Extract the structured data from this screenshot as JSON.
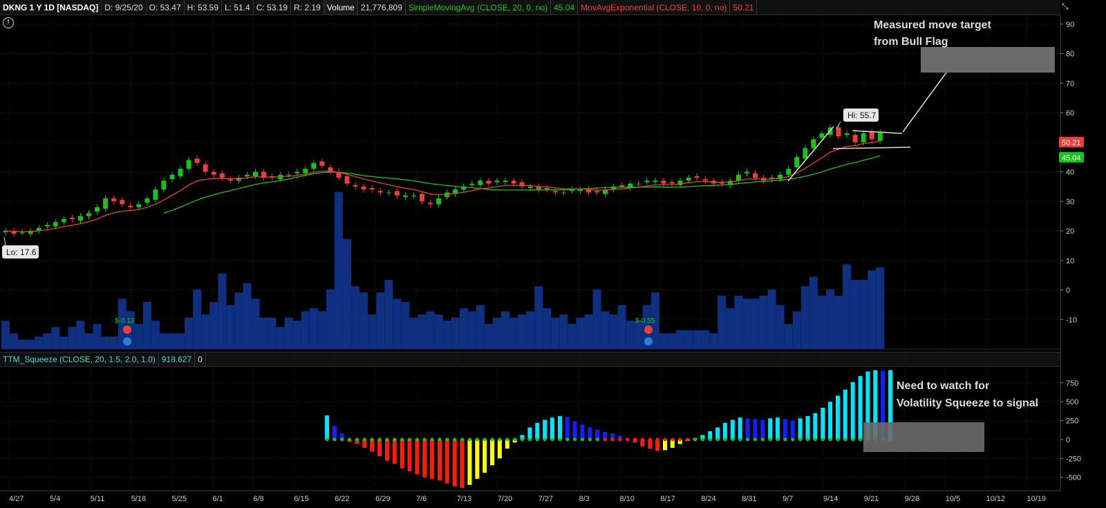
{
  "header": {
    "symbol": "DKNG 1 Y 1D [NASDAQ]",
    "date": "D: 9/25/20",
    "open": "O: 53.47",
    "high": "H: 53.59",
    "low": "L: 51.4",
    "close": "C: 53.19",
    "range": "R: 2.19",
    "volume_label": "Volume",
    "volume_value": "21,776,809",
    "sma_label": "SimpleMovingAvg (CLOSE, 20, 0, no)",
    "sma_value": "45.04",
    "ema_label": "MovAvgExponential (CLOSE, 10, 0, no)",
    "ema_value": "50.21",
    "colors": {
      "sma": "#19c21b",
      "ema": "#e8403a",
      "up": "#19c21b",
      "down": "#e8403a",
      "volume": "#0f2f80"
    }
  },
  "squeeze_header": {
    "label": "TTM_Squeeze (CLOSE, 20, 1.5, 2.0, 1.0)",
    "value": "918.627",
    "squeeze": "0"
  },
  "annotations": {
    "top_note": [
      "Measured move target",
      "from Bull Flag"
    ],
    "bottom_note": [
      "Need to watch for",
      "Volatility Squeeze to signal"
    ],
    "hi_label": "Hi: 55.7",
    "lo_label": "Lo: 17.6",
    "ema_badge": "50.21",
    "sma_badge": "45.04",
    "earnings_1": "$-0.13",
    "earnings_2": "$-0.55"
  },
  "chart_data": [
    {
      "type": "candlestick",
      "title": "DKNG 1 Y 1D [NASDAQ]",
      "x_labels": [
        "4/27",
        "5/4",
        "5/11",
        "5/18",
        "5/25",
        "6/1",
        "6/8",
        "6/15",
        "6/22",
        "6/29",
        "7/6",
        "7/13",
        "7/20",
        "7/27",
        "8/3",
        "8/10",
        "8/17",
        "8/24",
        "8/31",
        "9/7",
        "9/14",
        "9/21",
        "9/28",
        "10/5",
        "10/12",
        "10/19"
      ],
      "y_ticks": [
        -10,
        0,
        10,
        20,
        30,
        40,
        50,
        60,
        70,
        80,
        90
      ],
      "ylim": [
        -20,
        93
      ],
      "close": [
        20,
        19,
        19.5,
        20,
        21,
        22,
        23,
        24,
        24,
        25,
        26,
        28,
        31,
        30,
        29,
        28,
        29,
        31,
        34,
        37,
        39,
        41,
        44,
        43,
        40,
        39,
        38,
        37,
        38,
        39,
        40,
        38,
        38,
        39,
        39,
        40,
        41,
        43,
        42,
        40,
        38,
        36,
        35,
        34,
        34,
        33,
        33,
        32,
        32,
        32,
        30,
        29,
        31,
        33,
        34,
        35,
        36,
        37,
        36,
        37,
        37,
        36,
        35,
        35,
        34,
        34,
        33,
        33,
        34,
        34,
        33,
        33,
        34,
        35,
        35,
        36,
        36,
        37,
        37,
        36,
        36,
        37,
        38,
        38,
        37,
        36,
        36,
        37,
        39,
        40,
        38,
        37,
        38,
        39,
        41,
        45,
        48,
        51,
        53,
        55,
        52,
        53,
        50,
        53,
        51,
        53.19
      ],
      "volume_million": [
        9,
        5,
        3,
        3,
        4,
        5,
        7,
        4,
        7,
        9,
        5,
        8,
        4,
        4,
        16,
        12,
        8,
        15,
        9,
        5,
        5,
        5,
        10,
        19,
        11,
        15,
        24,
        14,
        18,
        21,
        16,
        10,
        10,
        7,
        10,
        9,
        12,
        13,
        12,
        19,
        50,
        35,
        20,
        18,
        11,
        18,
        22,
        16,
        15,
        10,
        11,
        12,
        11,
        9,
        10,
        13,
        12,
        14,
        8,
        10,
        12,
        10,
        11,
        12,
        20,
        13,
        10,
        11,
        8,
        10,
        11,
        19,
        12,
        11,
        14,
        9,
        9,
        14,
        18,
        5,
        5,
        6,
        6,
        6,
        6,
        5,
        17,
        13,
        17,
        16,
        16,
        17,
        19,
        14,
        8,
        12,
        20,
        23,
        17,
        19,
        17,
        27,
        22,
        22,
        25,
        26
      ],
      "sma20": "rising from 24 to 45.04",
      "ema10": "ending at 50.21",
      "high": 55.7,
      "low": 17.6
    },
    {
      "type": "bar",
      "title": "TTM_Squeeze (CLOSE, 20, 1.5, 2.0, 1.0)",
      "y_ticks": [
        -500,
        -250,
        0,
        250,
        500,
        750
      ],
      "ylim": [
        -650,
        950
      ],
      "values": [
        320,
        180,
        80,
        -30,
        -60,
        -110,
        -160,
        -220,
        -280,
        -320,
        -380,
        -420,
        -460,
        -500,
        -520,
        -540,
        -580,
        -620,
        -640,
        -600,
        -520,
        -440,
        -340,
        -250,
        -120,
        -40,
        60,
        160,
        220,
        260,
        290,
        310,
        300,
        240,
        200,
        160,
        130,
        100,
        80,
        50,
        20,
        -40,
        -90,
        -120,
        -150,
        -140,
        -110,
        -60,
        -20,
        20,
        60,
        110,
        160,
        220,
        260,
        290,
        280,
        270,
        260,
        280,
        290,
        270,
        250,
        280,
        310,
        350,
        420,
        500,
        580,
        660,
        760,
        840,
        900,
        918,
        910,
        918.627
      ],
      "colors": {
        "pos_rising": "#00e5ff",
        "pos_falling": "#1020ff",
        "neg_falling": "#ff1a0d",
        "neg_rising": "#ffff00",
        "dot_on": "#19c21b",
        "dot_off": "#ff1a0d"
      }
    }
  ]
}
